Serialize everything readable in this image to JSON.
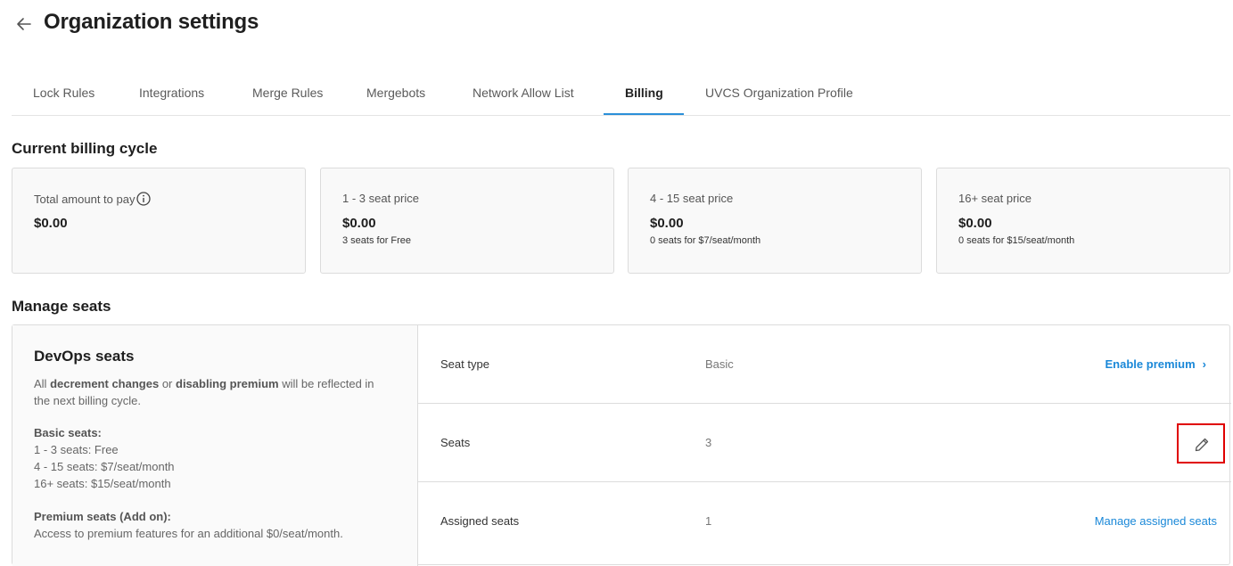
{
  "header": {
    "title": "Organization settings"
  },
  "tabs": [
    {
      "label": "Lock Rules"
    },
    {
      "label": "Integrations"
    },
    {
      "label": "Merge Rules"
    },
    {
      "label": "Mergebots"
    },
    {
      "label": "Network Allow List"
    },
    {
      "label": "Billing",
      "active": true
    },
    {
      "label": "UVCS Organization Profile"
    }
  ],
  "billing": {
    "title": "Current billing cycle",
    "cards": [
      {
        "label": "Total amount to pay",
        "amount": "$0.00",
        "sub": ""
      },
      {
        "label": "1 - 3 seat price",
        "amount": "$0.00",
        "sub": "3 seats for Free"
      },
      {
        "label": "4 - 15 seat price",
        "amount": "$0.00",
        "sub": "0 seats for $7/seat/month"
      },
      {
        "label": "16+ seat price",
        "amount": "$0.00",
        "sub": "0 seats for $15/seat/month"
      }
    ]
  },
  "manage": {
    "title": "Manage seats",
    "devops_title": "DevOps seats",
    "desc_all": "All",
    "desc_decrement": "decrement changes",
    "desc_or": "or",
    "desc_disabling": "disabling premium",
    "desc_will": "will be reflected in",
    "desc_next": "the next billing cycle.",
    "basic_heading": "Basic seats:",
    "basic_lines": [
      "1 - 3 seats: Free",
      "4 - 15 seats: $7/seat/month",
      "16+ seats: $15/seat/month"
    ],
    "premium_heading": "Premium seats (Add on):",
    "premium_line": "Access to premium features for an additional $0/seat/month.",
    "rows": {
      "seat_type": {
        "label": "Seat type",
        "value": "Basic",
        "action": "Enable premium"
      },
      "seats": {
        "label": "Seats",
        "value": "3"
      },
      "assigned": {
        "label": "Assigned seats",
        "value": "1",
        "action": "Manage assigned seats"
      }
    }
  },
  "colors": {
    "accent": "#1a88d8",
    "tab_underline": "#2b8fd9",
    "highlight": "#e00000"
  },
  "icons": {
    "back": "arrow-left-icon",
    "info": "info-icon",
    "edit": "pencil-icon",
    "chevron": "chevron-right-icon"
  }
}
